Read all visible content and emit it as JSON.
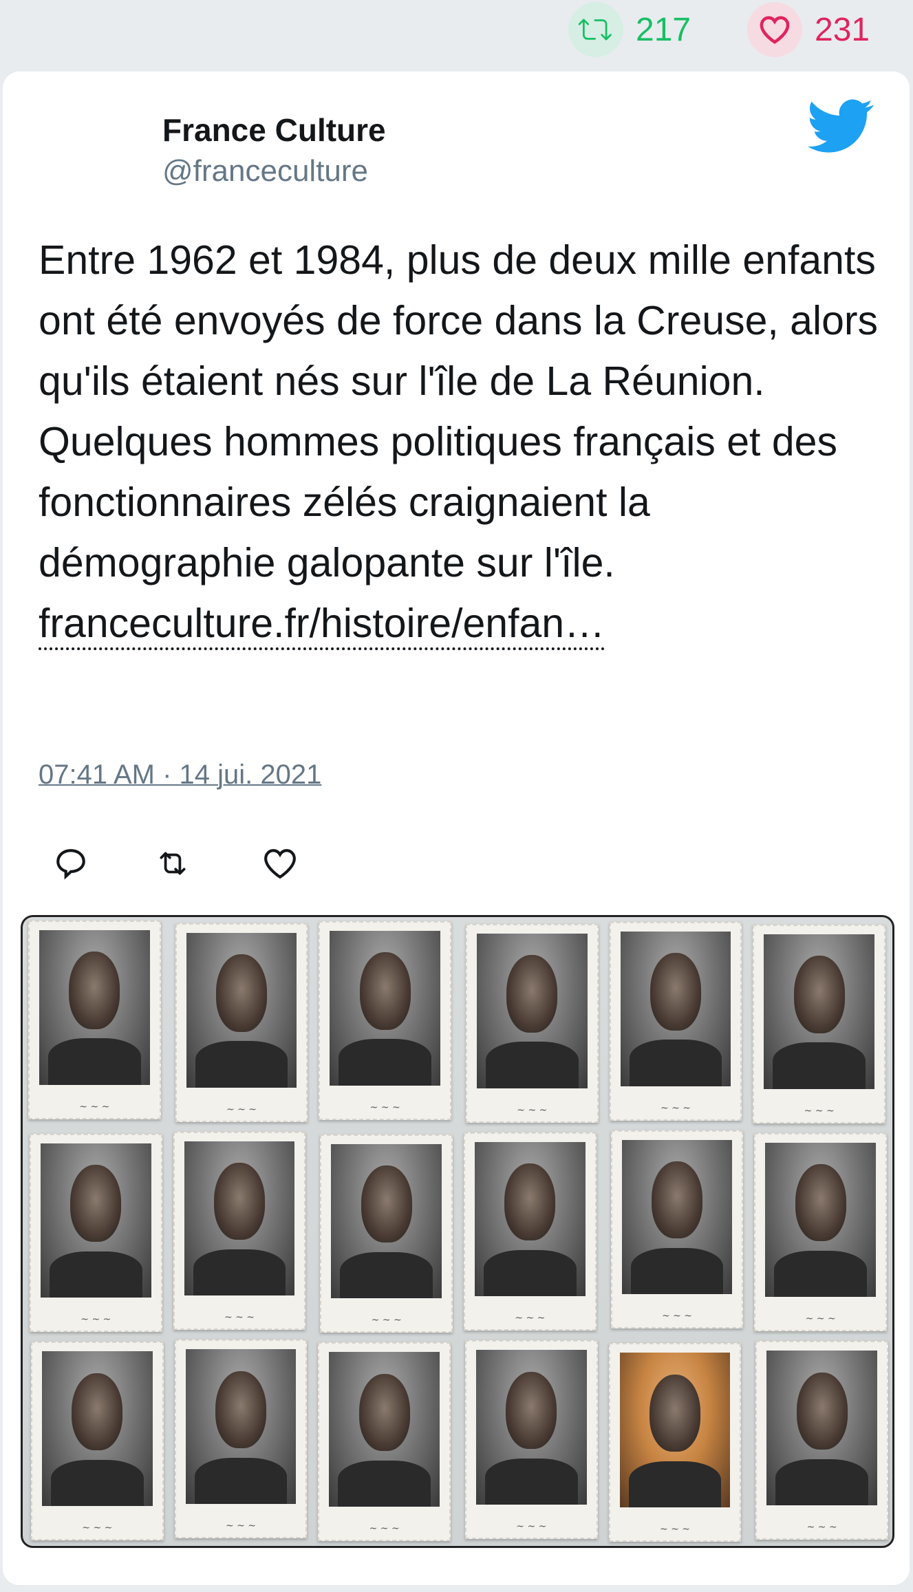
{
  "stats": {
    "retweets": "217",
    "likes": "231",
    "retweet_icon": "retweet-icon",
    "like_icon": "heart-icon",
    "retweet_color": "#17bf63",
    "like_color": "#e0245e"
  },
  "tweet": {
    "author_name": "France Culture",
    "author_handle": "@franceculture",
    "text": "Entre 1962 et 1984, plus de deux mille enfants ont été envoyés de force dans la Creuse, alors qu'ils étaient nés sur l'île de La Réunion. Quelques hommes politiques français et des fonctionnaires zélés craignaient la démographie galopante sur l'île.",
    "link_text": "franceculture.fr/histoire/enfan…",
    "timestamp": "07:41 AM · 14 jui. 2021",
    "brand_icon": "twitter-bird-icon",
    "brand_color": "#1da1f2"
  },
  "actions": [
    "reply-icon",
    "retweet-icon",
    "like-icon"
  ],
  "photo": {
    "description_icon": "portrait-grid-image",
    "rows": 3,
    "columns": 6,
    "color_portrait_index": 16
  }
}
